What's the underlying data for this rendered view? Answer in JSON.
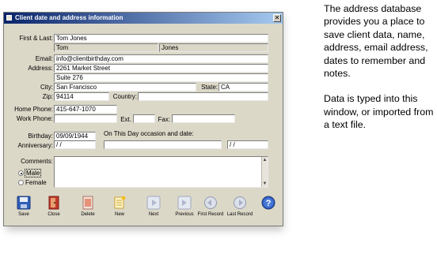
{
  "window": {
    "title": "Client date and address information",
    "close_glyph": "✕"
  },
  "form": {
    "first_last_label": "First & Last:",
    "full_name": "Tom Jones",
    "first_name": "Tom",
    "last_name": "Jones",
    "email_label": "Email:",
    "email": "info@clientbirthday.com",
    "address_label": "Address:",
    "address1": "2261 Market Street",
    "address2": "Suite 276",
    "city_label": "City:",
    "city": "San Francisco",
    "state_label": "State:",
    "state": "CA",
    "zip_label": "Zip:",
    "zip": "94114",
    "country_label": "Country:",
    "country": "",
    "home_phone_label": "Home Phone:",
    "home_phone": "415-647-1070",
    "work_phone_label": "Work Phone:",
    "work_phone": "",
    "ext_label": "Ext.",
    "ext": "",
    "fax_label": "Fax:",
    "fax": "",
    "birthday_label": "Birthday:",
    "birthday": "09/09/1944",
    "on_this_day_label": "On This Day occasion and date:",
    "anniversary_label": "Anniversary:",
    "anniversary": " / /",
    "occasion": "",
    "occasion_date": " / /",
    "comments_label": "Comments:",
    "comments": "",
    "gender_male": "Male",
    "gender_female": "Female",
    "gender_selected": "Male"
  },
  "toolbar": [
    {
      "label": "Save",
      "icon": "save-icon"
    },
    {
      "label": "Close",
      "icon": "close-door-icon"
    },
    {
      "label": "Delete",
      "icon": "delete-icon"
    },
    {
      "label": "New",
      "icon": "new-record-icon"
    },
    {
      "label": "Next",
      "icon": "next-icon"
    },
    {
      "label": "Previous",
      "icon": "previous-icon"
    },
    {
      "label": "First Record",
      "icon": "first-record-icon"
    },
    {
      "label": "Last Record",
      "icon": "last-record-icon"
    },
    {
      "label": "",
      "icon": "help-icon"
    }
  ],
  "caption": {
    "paragraph1": "The address database provides you a place to save client data, name, address, email address, dates to remember and notes.",
    "paragraph2": "Data is typed into this window, or imported from a text file."
  },
  "colors": {
    "window_bg": "#dcd8c8",
    "title_start": "#0a246a",
    "title_end": "#a6caf0"
  }
}
